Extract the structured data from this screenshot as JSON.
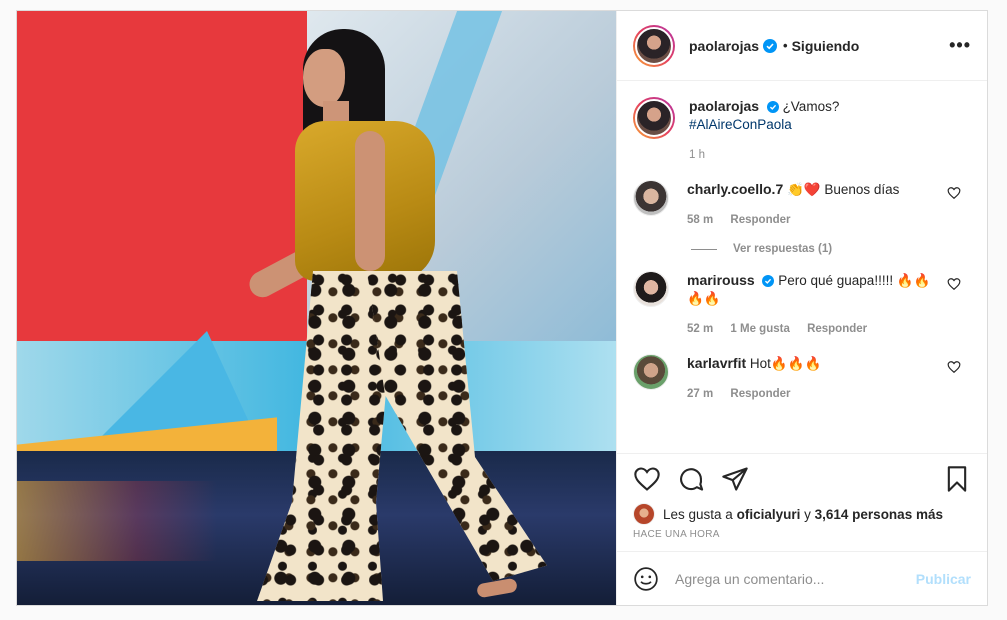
{
  "post": {
    "author": "paolarojas",
    "follow_status": "Siguiendo",
    "separator": "•",
    "more_label": "•••",
    "caption_text": "¿Vamos?",
    "caption_hashtag": "#AlAireConPaola",
    "caption_time": "1 h"
  },
  "comments": [
    {
      "user": "charly.coello.7",
      "text": "👏❤️ Buenos días",
      "time": "58 m",
      "likes": "",
      "reply_label": "Responder",
      "view_replies": "Ver respuestas (1)"
    },
    {
      "user": "marirouss",
      "text": "Pero qué guapa!!!!! 🔥🔥🔥🔥",
      "time": "52 m",
      "likes": "1 Me gusta",
      "reply_label": "Responder"
    },
    {
      "user": "karlavrfit",
      "text": "Hot🔥🔥🔥",
      "time": "27 m",
      "likes": "",
      "reply_label": "Responder"
    }
  ],
  "likes": {
    "prefix": "Les gusta a",
    "user": "oficialyuri",
    "middle": "y",
    "count": "3,614 personas más"
  },
  "timestamp": "HACE UNA HORA",
  "add_comment": {
    "placeholder": "Agrega un comentario...",
    "publish_label": "Publicar"
  },
  "colors": {
    "link": "#00376b",
    "verified": "#0095f6",
    "publish_disabled": "#b2dffc",
    "muted": "#8e8e8e"
  },
  "icons": [
    "more-icon",
    "verified-icon",
    "heart-icon",
    "comment-icon",
    "share-icon",
    "bookmark-icon",
    "emoji-icon"
  ]
}
